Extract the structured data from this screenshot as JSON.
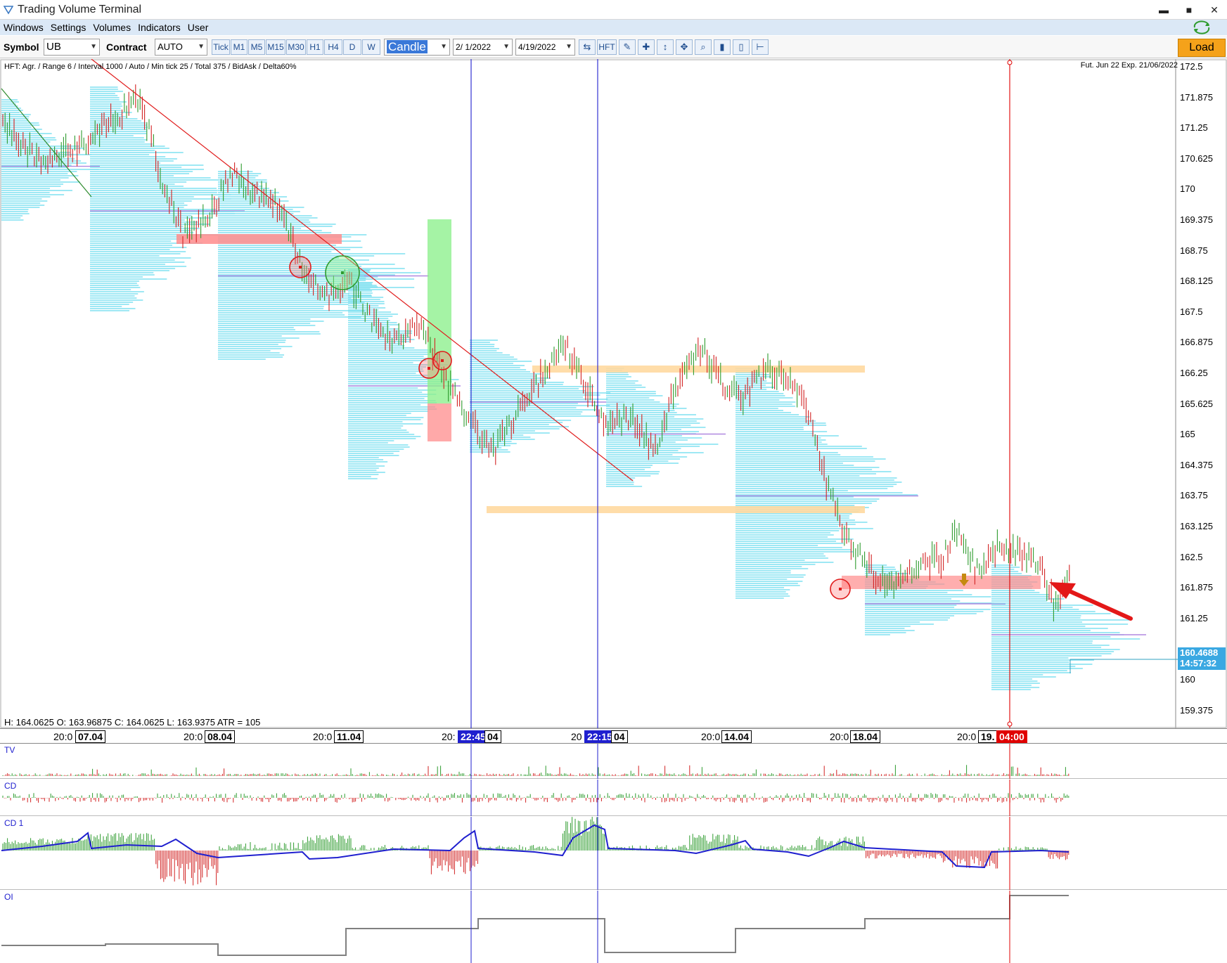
{
  "window": {
    "title": "Trading Volume Terminal",
    "controls": [
      "▬",
      "■",
      "✕"
    ]
  },
  "menu": [
    "Windows",
    "Settings",
    "Volumes",
    "Indicators",
    "User"
  ],
  "toolbar": {
    "symbol_label": "Symbol",
    "symbol_value": "UB",
    "contract_label": "Contract",
    "contract_value": "AUTO",
    "timeframes": [
      "Tick",
      "M1",
      "M5",
      "M15",
      "M30",
      "H1",
      "H4",
      "D",
      "W"
    ],
    "chart_type": "Candle",
    "date_from": "2/ 1/2022",
    "date_to": "4/19/2022",
    "hft_label": "HFT",
    "load_label": "Load"
  },
  "chart": {
    "info": "HFT: Agr. / Range 6 / Interval 1000 / Auto / Min tick 25 / Total 375 / BidAsk / Delta60%",
    "contract_info": "Fut. Jun 22 Exp. 21/06/2022",
    "ohlc": "H: 164.0625   O: 163.96875   C: 164.0625   L: 163.9375   ATR = 105",
    "last_price": "160.4688",
    "countdown": "14:57:32",
    "price_labels": [
      "172.5",
      "171.875",
      "171.25",
      "170.625",
      "170",
      "169.375",
      "168.75",
      "168.125",
      "167.5",
      "166.875",
      "166.25",
      "165.625",
      "165",
      "164.375",
      "163.75",
      "163.125",
      "162.5",
      "161.875",
      "161.25",
      "160",
      "159.375"
    ],
    "time_labels": [
      {
        "t": "20:0",
        "d": "07.04"
      },
      {
        "t": "20:0",
        "d": "08.04"
      },
      {
        "t": "20:0",
        "d": "11.04"
      },
      {
        "t": "20:",
        "d": "22:45",
        "rest": "04"
      },
      {
        "t": "20",
        "d": "22:15",
        "rest": "04"
      },
      {
        "t": "20:0",
        "d": "14.04"
      },
      {
        "t": "20:0",
        "d": "18.04"
      },
      {
        "t": "20:0",
        "d": "19.",
        "red": "04:00"
      }
    ],
    "colors": {
      "up": "#2e9b2e",
      "down": "#d22222",
      "profile": "#7fe0f0",
      "zone_red": "#ff8c8c",
      "zone_orange": "#ffd9a0",
      "zone_green": "#8ff08f",
      "cursor_blue": "#1f1fcf",
      "cursor_red": "#e00000"
    }
  },
  "panels": [
    {
      "name": "TV"
    },
    {
      "name": "CD"
    },
    {
      "name": "CD 1"
    },
    {
      "name": "OI"
    }
  ]
}
